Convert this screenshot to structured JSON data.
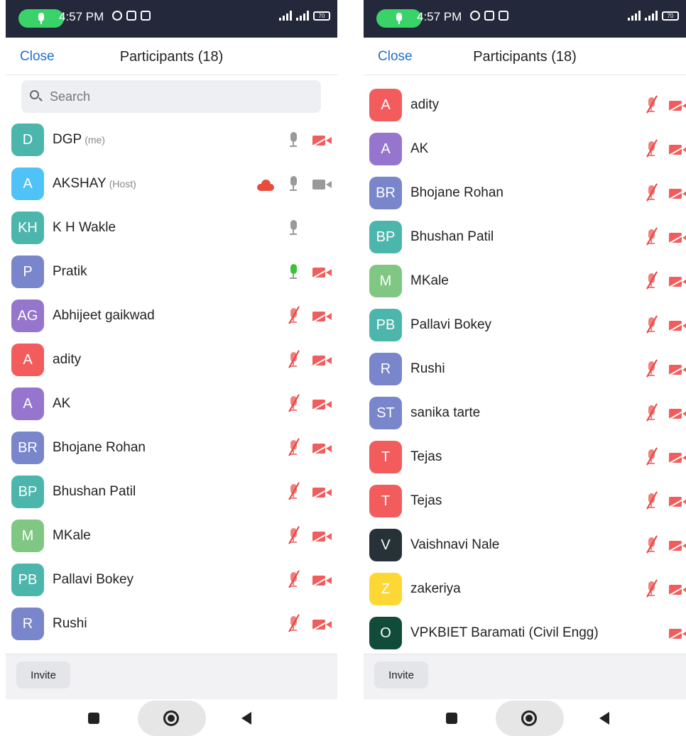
{
  "status_bar": {
    "time": "4:57 PM",
    "battery": "70",
    "network": "4G"
  },
  "header": {
    "close_label": "Close",
    "title": "Participants (18)"
  },
  "search": {
    "placeholder": "Search"
  },
  "footer": {
    "invite_label": "Invite"
  },
  "colors": {
    "red": "#f25c5c",
    "blue": "#4fc3f7",
    "teal": "#4db6ac",
    "indigo": "#7986cb",
    "purple": "#9575cd",
    "green": "#81c784",
    "dark": "#263238",
    "yellow": "#fdd835",
    "darkgreen": "#114b3a"
  },
  "left_screen": {
    "participants": [
      {
        "initials": "D",
        "name": "DGP",
        "tag": "(me)",
        "color": "#4db6ac",
        "mic": "on",
        "cam": "off"
      },
      {
        "initials": "A",
        "name": "AKSHAY",
        "tag": "(Host)",
        "color": "#4fc3f7",
        "mic": "on",
        "cam": "on",
        "cloud": true
      },
      {
        "initials": "KH",
        "name": "K H Wakle",
        "tag": "",
        "color": "#4db6ac",
        "mic": "on",
        "cam": "none"
      },
      {
        "initials": "P",
        "name": "Pratik",
        "tag": "",
        "color": "#7986cb",
        "mic": "active",
        "cam": "off"
      },
      {
        "initials": "AG",
        "name": "Abhijeet gaikwad",
        "tag": "",
        "color": "#9575cd",
        "mic": "muted",
        "cam": "off"
      },
      {
        "initials": "A",
        "name": "adity",
        "tag": "",
        "color": "#f25c5c",
        "mic": "muted",
        "cam": "off"
      },
      {
        "initials": "A",
        "name": "AK",
        "tag": "",
        "color": "#9575cd",
        "mic": "muted",
        "cam": "off"
      },
      {
        "initials": "BR",
        "name": "Bhojane Rohan",
        "tag": "",
        "color": "#7986cb",
        "mic": "muted",
        "cam": "off"
      },
      {
        "initials": "BP",
        "name": "Bhushan Patil",
        "tag": "",
        "color": "#4db6ac",
        "mic": "muted",
        "cam": "off"
      },
      {
        "initials": "M",
        "name": "MKale",
        "tag": "",
        "color": "#81c784",
        "mic": "muted",
        "cam": "off"
      },
      {
        "initials": "PB",
        "name": "Pallavi Bokey",
        "tag": "",
        "color": "#4db6ac",
        "mic": "muted",
        "cam": "off"
      },
      {
        "initials": "R",
        "name": "Rushi",
        "tag": "",
        "color": "#7986cb",
        "mic": "muted",
        "cam": "off"
      }
    ]
  },
  "right_screen": {
    "participants": [
      {
        "initials": "A",
        "name": "adity",
        "tag": "",
        "color": "#f25c5c",
        "mic": "muted",
        "cam": "off"
      },
      {
        "initials": "A",
        "name": "AK",
        "tag": "",
        "color": "#9575cd",
        "mic": "muted",
        "cam": "off"
      },
      {
        "initials": "BR",
        "name": "Bhojane Rohan",
        "tag": "",
        "color": "#7986cb",
        "mic": "muted",
        "cam": "off"
      },
      {
        "initials": "BP",
        "name": "Bhushan Patil",
        "tag": "",
        "color": "#4db6ac",
        "mic": "muted",
        "cam": "off"
      },
      {
        "initials": "M",
        "name": "MKale",
        "tag": "",
        "color": "#81c784",
        "mic": "muted",
        "cam": "off"
      },
      {
        "initials": "PB",
        "name": "Pallavi Bokey",
        "tag": "",
        "color": "#4db6ac",
        "mic": "muted",
        "cam": "off"
      },
      {
        "initials": "R",
        "name": "Rushi",
        "tag": "",
        "color": "#7986cb",
        "mic": "muted",
        "cam": "off"
      },
      {
        "initials": "ST",
        "name": "sanika tarte",
        "tag": "",
        "color": "#7986cb",
        "mic": "muted",
        "cam": "off"
      },
      {
        "initials": "T",
        "name": "Tejas",
        "tag": "",
        "color": "#f25c5c",
        "mic": "muted",
        "cam": "off"
      },
      {
        "initials": "T",
        "name": "Tejas",
        "tag": "",
        "color": "#f25c5c",
        "mic": "muted",
        "cam": "off"
      },
      {
        "initials": "V",
        "name": "Vaishnavi Nale",
        "tag": "",
        "color": "#263238",
        "mic": "muted",
        "cam": "off"
      },
      {
        "initials": "Z",
        "name": "zakeriya",
        "tag": "",
        "color": "#fdd835",
        "mic": "muted",
        "cam": "off"
      },
      {
        "initials": "O",
        "name": "VPKBIET  Baramati (Civil Engg)",
        "tag": "",
        "color": "#114b3a",
        "mic": "none",
        "cam": "off"
      }
    ]
  }
}
